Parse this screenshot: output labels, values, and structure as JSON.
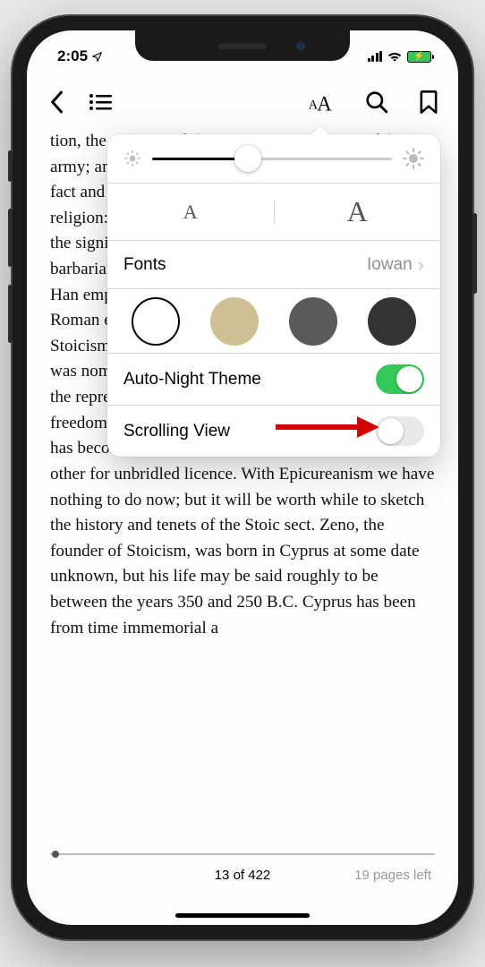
{
  "status": {
    "time": "2:05"
  },
  "popover": {
    "fonts_label": "Fonts",
    "fonts_value": "Iowan",
    "auto_night_label": "Auto-Night Theme",
    "auto_night_on": true,
    "scrolling_label": "Scrolling View",
    "scrolling_on": false,
    "size_small": "A",
    "size_large": "A",
    "themes": [
      {
        "name": "white",
        "color": "#ffffff",
        "selected": true
      },
      {
        "name": "sepia",
        "color": "#cfbf93"
      },
      {
        "name": "gray",
        "color": "#5a5a5a"
      },
      {
        "name": "black",
        "color": "#333333"
      }
    ],
    "brightness": 0.4
  },
  "page": {
    "text": "tion, the empire and the emperor; importance of the army; an age without hope; superstition and curiosity; fact and fiction about the Druids; first century magic; religion: Jupiter Greatest and Best; Juventas or Hebe; the significance of Mithras were taken seriously; the barbarians in the first century; Rome and the Chinese Han empire; the Greek world; the cultural life of the Roman empire; the divide between the rival sects of Stoicism and Epicureanism. The ideal set before each was nominally much the same. The Stoics aspired to the repression of all emotion, and the Epicureans to freedom from all disturbance; yet in the upshot the one has become a synonym of stubborn endurance, the other for unbridled licence. With Epicureanism we have nothing to do now; but it will be worth while to sketch the history and tenets of the Stoic sect. Zeno, the founder of Stoicism, was born in Cyprus at some date unknown, but his life may be said roughly to be between the years 350 and 250 B.C. Cyprus has been from time immemorial a"
  },
  "footer": {
    "progress": 0.03,
    "page_count": "13 of 422",
    "pages_left": "19 pages left"
  }
}
